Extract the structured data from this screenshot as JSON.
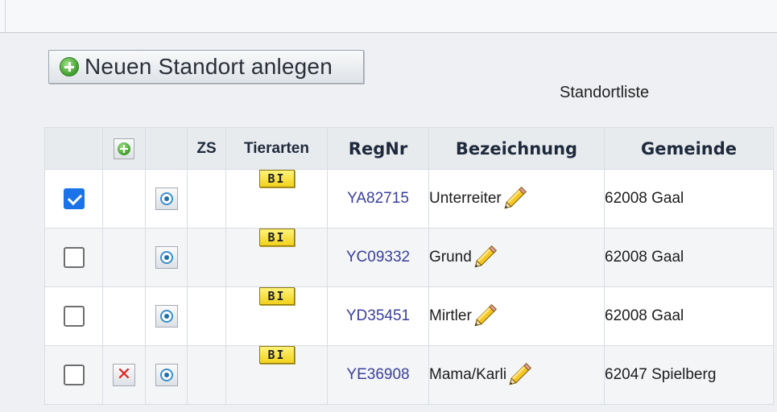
{
  "toolbar": {
    "add_button_label": "Neuen Standort anlegen"
  },
  "list_title": "Standortliste",
  "table": {
    "columns": {
      "zs": "ZS",
      "tierarten": "Tierarten",
      "regnr": "RegNr",
      "bezeichnung": "Bezeichnung",
      "gemeinde": "Gemeinde"
    },
    "rows": [
      {
        "checked": true,
        "deletable": false,
        "tierart": "BI",
        "regnr": "YA82715",
        "bezeichnung": "Unterreiter",
        "gemeinde": "62008 Gaal"
      },
      {
        "checked": false,
        "deletable": false,
        "tierart": "BI",
        "regnr": "YC09332",
        "bezeichnung": "Grund",
        "gemeinde": "62008 Gaal"
      },
      {
        "checked": false,
        "deletable": false,
        "tierart": "BI",
        "regnr": "YD35451",
        "bezeichnung": "Mirtler",
        "gemeinde": "62008 Gaal"
      },
      {
        "checked": false,
        "deletable": true,
        "tierart": "BI",
        "regnr": "YE36908",
        "bezeichnung": "Mama/Karli",
        "gemeinde": "62047 Spielberg"
      }
    ]
  },
  "icons": {
    "add": "plus-circle-icon",
    "view": "view-icon",
    "delete": "delete-icon",
    "edit": "pencil-icon"
  },
  "colors": {
    "link": "#3a3f9c",
    "checkbox_checked": "#1a73e8",
    "badge": "#f5dc2a",
    "delete": "#e02020"
  }
}
